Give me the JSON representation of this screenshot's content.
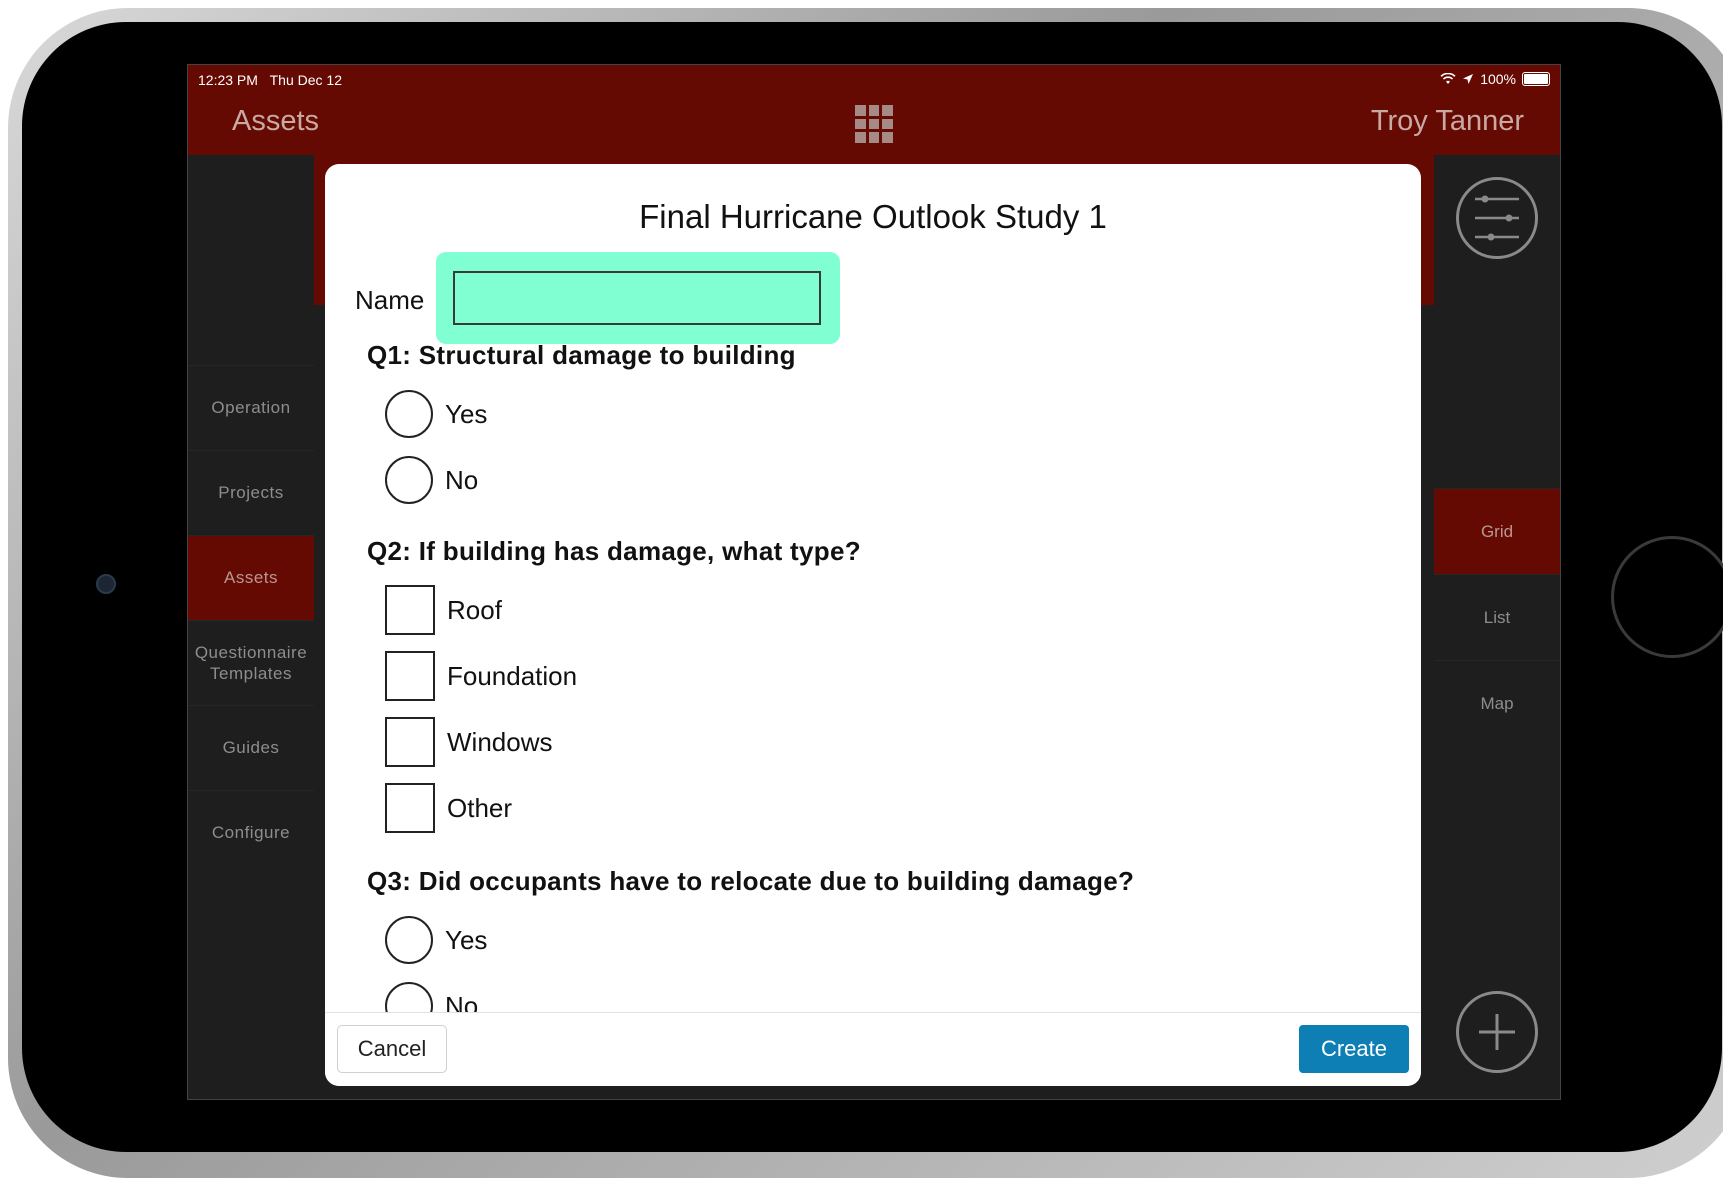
{
  "status_bar": {
    "time": "12:23 PM",
    "date": "Thu Dec 12",
    "battery": "100%"
  },
  "nav": {
    "title": "Assets",
    "user": "Troy Tanner",
    "center_icon": "grid-icon"
  },
  "sidebar": {
    "items": [
      {
        "label": "Operation",
        "active": false
      },
      {
        "label": "Projects",
        "active": false
      },
      {
        "label": "Assets",
        "active": true
      },
      {
        "label": "Questionnaire Templates",
        "active": false
      },
      {
        "label": "Guides",
        "active": false
      },
      {
        "label": "Configure",
        "active": false
      }
    ]
  },
  "rightbar": {
    "filter_icon": "sliders-icon",
    "items": [
      {
        "label": "Grid",
        "active": true
      },
      {
        "label": "List",
        "active": false
      },
      {
        "label": "Map",
        "active": false
      }
    ],
    "add_icon": "plus-icon"
  },
  "modal": {
    "title": "Final Hurricane Outlook Study 1",
    "name_label": "Name",
    "name_value": "",
    "questions": [
      {
        "text": "Q1: Structural damage to building",
        "type": "radio",
        "options": [
          "Yes",
          "No"
        ]
      },
      {
        "text": "Q2: If building has damage, what type?",
        "type": "checkbox",
        "options": [
          "Roof",
          "Foundation",
          "Windows",
          "Other"
        ]
      },
      {
        "text": "Q3: Did occupants have to relocate due to building damage?",
        "type": "radio",
        "options": [
          "Yes",
          "No"
        ]
      }
    ],
    "cancel_label": "Cancel",
    "create_label": "Create"
  },
  "colors": {
    "header": "#650a02",
    "accent": "#0d7fb5",
    "highlight": "#80ffd2"
  }
}
